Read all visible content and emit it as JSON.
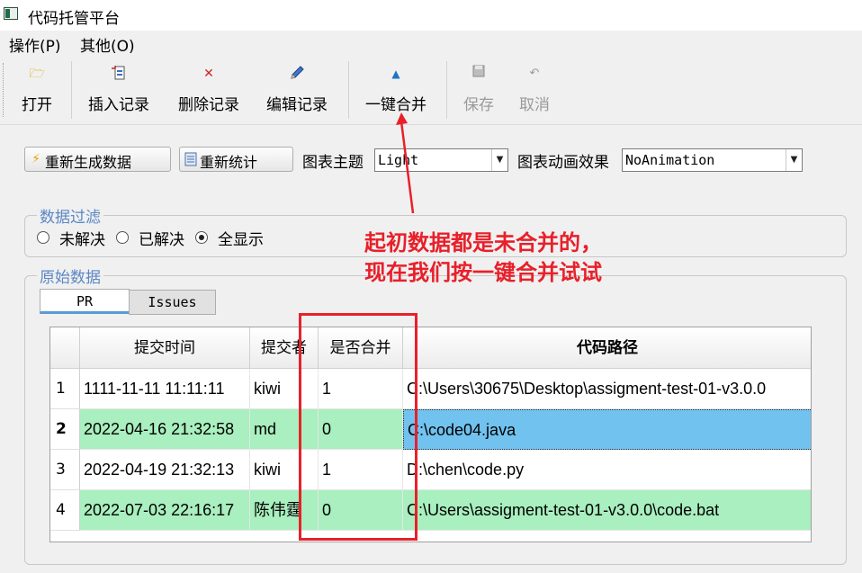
{
  "window": {
    "title": "代码托管平台"
  },
  "menu": [
    {
      "label": "操作(P)"
    },
    {
      "label": "其他(O)"
    }
  ],
  "toolbar": {
    "open": "打开",
    "insert": "插入记录",
    "delete": "删除记录",
    "edit": "编辑记录",
    "merge": "一键合并",
    "save": "保存",
    "cancel": "取消"
  },
  "controls": {
    "regen_button": "重新生成数据",
    "restat_button": "重新统计",
    "theme_label": "图表主题",
    "theme_value": "Light",
    "anim_label": "图表动画效果",
    "anim_value": "NoAnimation"
  },
  "filter": {
    "title": "数据过滤",
    "options": [
      {
        "label": "未解决",
        "checked": false
      },
      {
        "label": "已解决",
        "checked": false
      },
      {
        "label": "全显示",
        "checked": true
      }
    ]
  },
  "raw": {
    "title": "原始数据",
    "tabs": [
      {
        "label": "PR",
        "active": true
      },
      {
        "label": "Issues",
        "active": false
      }
    ]
  },
  "table": {
    "columns": [
      "提交时间",
      "提交者",
      "是否合并",
      "代码路径"
    ],
    "rows": [
      {
        "index": "1",
        "time": "1111-11-11 11:11:11",
        "author": "kiwi",
        "merged": "1",
        "path": "C:\\Users\\30675\\Desktop\\assigment-test-01-v3.0.0",
        "highlight": false
      },
      {
        "index": "2",
        "time": "2022-04-16 21:32:58",
        "author": "md",
        "merged": "0",
        "path": "C:\\code04.java",
        "highlight": true
      },
      {
        "index": "3",
        "time": "2022-04-19 21:32:13",
        "author": "kiwi",
        "merged": "1",
        "path": "D:\\chen\\code.py",
        "highlight": false
      },
      {
        "index": "4",
        "time": "2022-07-03 22:16:17",
        "author": "陈伟霆",
        "merged": "0",
        "path": "C:\\Users\\assigment-test-01-v3.0.0\\code.bat",
        "highlight": true
      }
    ]
  },
  "annotation": {
    "line1": "起初数据都是未合并的，",
    "line2": "现在我们按一键合并试试"
  },
  "colors": {
    "accent": "#5b87c4",
    "annotation": "#e8202a",
    "row_green": "#a9efbf",
    "selection": "#71c2ee"
  }
}
